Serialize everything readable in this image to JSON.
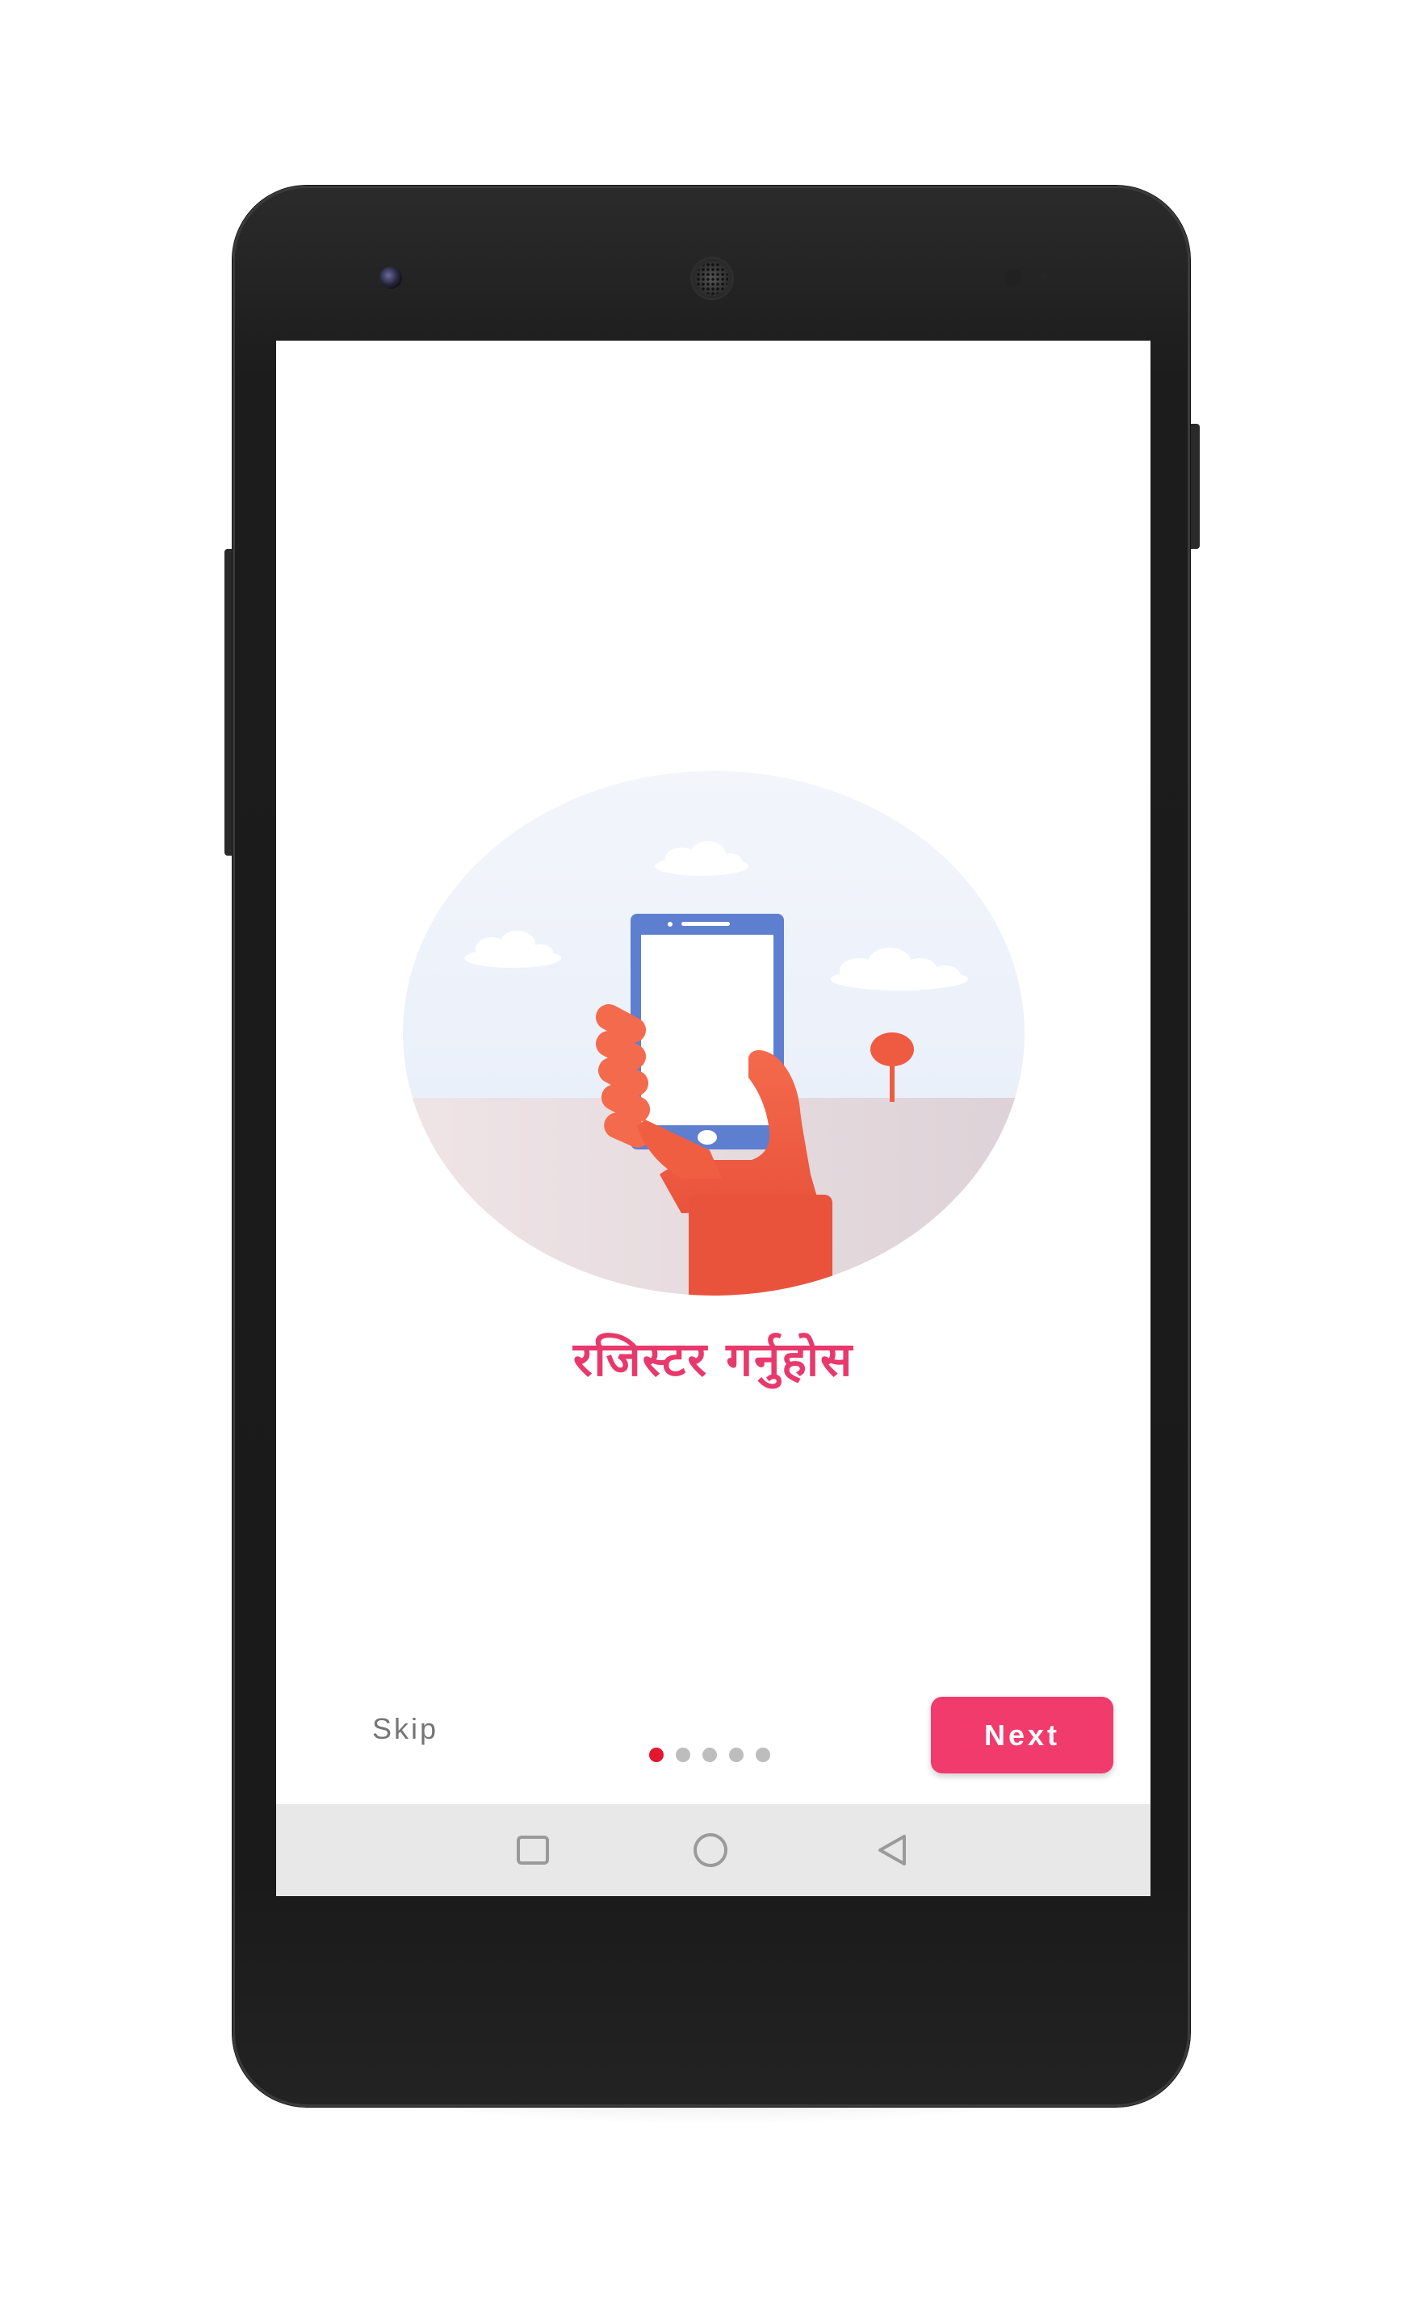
{
  "onboarding": {
    "title": "रजिस्टर गर्नुहोस",
    "skip_label": "Skip",
    "next_label": "Next",
    "pager": {
      "total_pages": 5,
      "current_page": 1
    }
  },
  "colors": {
    "accent": "#f23b6d",
    "title": "#e8386c",
    "active_dot": "#e3172e",
    "inactive_dot": "#bdbdbd",
    "nav_bar_background": "#e8e8e8"
  },
  "icons": {
    "recents": "square-outline",
    "home": "circle-outline",
    "back": "triangle-left-outline"
  }
}
